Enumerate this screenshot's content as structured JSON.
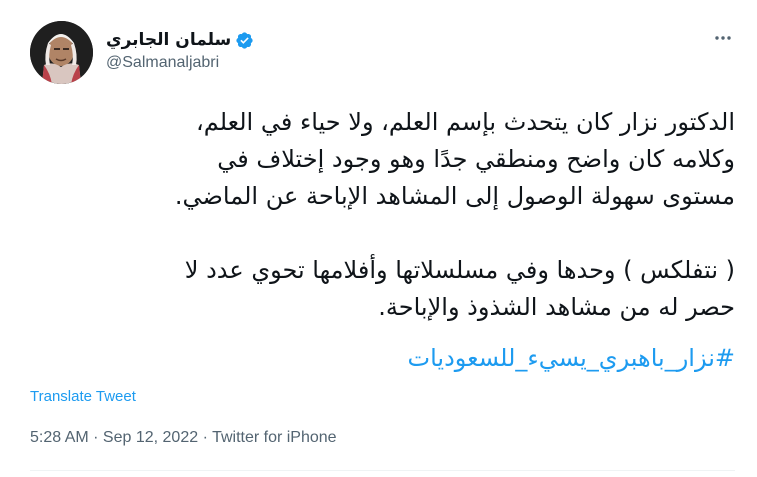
{
  "user": {
    "display_name": "سلمان الجابري",
    "handle": "@Salmanaljabri",
    "verified": true,
    "verified_color": "#1d9bf0"
  },
  "tweet": {
    "paragraph1": [
      "الدكتور نزار كان يتحدث بإسم العلم، ولا حياء في العلم،",
      "وكلامه كان واضح ومنطقي جدًا وهو وجود إختلاف في",
      "مستوى سهولة الوصول إلى المشاهد الإباحة عن الماضي."
    ],
    "paragraph2": [
      "( نتفلكس ) وحدها وفي مسلسلاتها وأفلامها تحوي عدد لا",
      "حصر له من مشاهد الشذوذ والإباحة."
    ],
    "hashtag": "#نزار_باهبري_يسيء_للسعوديات",
    "translate_label": "Translate Tweet"
  },
  "meta": {
    "time": "5:28 AM",
    "separator1": " · ",
    "date": "Sep 12, 2022",
    "separator2": " · ",
    "source": "Twitter for iPhone"
  },
  "icons": {
    "more": "more-horizontal-icon",
    "verified": "verified-badge-icon"
  },
  "colors": {
    "link": "#1d9bf0",
    "secondary_text": "#536471",
    "primary_text": "#0f1419"
  }
}
